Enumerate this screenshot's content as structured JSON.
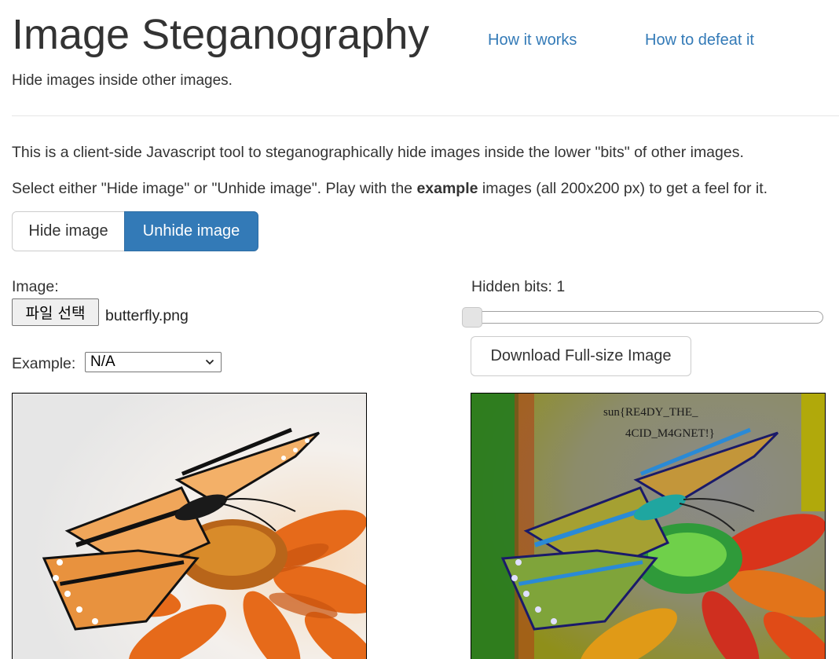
{
  "header": {
    "title": "Image Steganography",
    "subtitle": "Hide images inside other images.",
    "nav": [
      {
        "label": "How it works"
      },
      {
        "label": "How to defeat it"
      }
    ]
  },
  "intro": {
    "line1": "This is a client-side Javascript tool to steganographically hide images inside the lower \"bits\" of other images.",
    "line2_pre": "Select either \"Hide image\" or \"Unhide image\". Play with the ",
    "line2_bold": "example",
    "line2_post": " images (all 200x200 px) to get a feel for it."
  },
  "mode_toggle": {
    "options": [
      "Hide image",
      "Unhide image"
    ],
    "selected": "Unhide image"
  },
  "left_panel": {
    "image_label": "Image:",
    "file_button_label": "파일 선택",
    "file_name": "butterfly.png",
    "example_label": "Example:",
    "example_selected": "N/A"
  },
  "right_panel": {
    "hidden_bits_label": "Hidden bits: 1",
    "hidden_bits_value": 1,
    "download_button_label": "Download Full-size Image",
    "revealed_text_line1": "sun{RE4DY_THE_",
    "revealed_text_line2": "4CID_M4GNET!}"
  },
  "icons": {
    "select_arrow": "chevron-down-icon"
  },
  "colors": {
    "link": "#337ab7",
    "active_button": "#337ab7",
    "text": "#333333"
  }
}
